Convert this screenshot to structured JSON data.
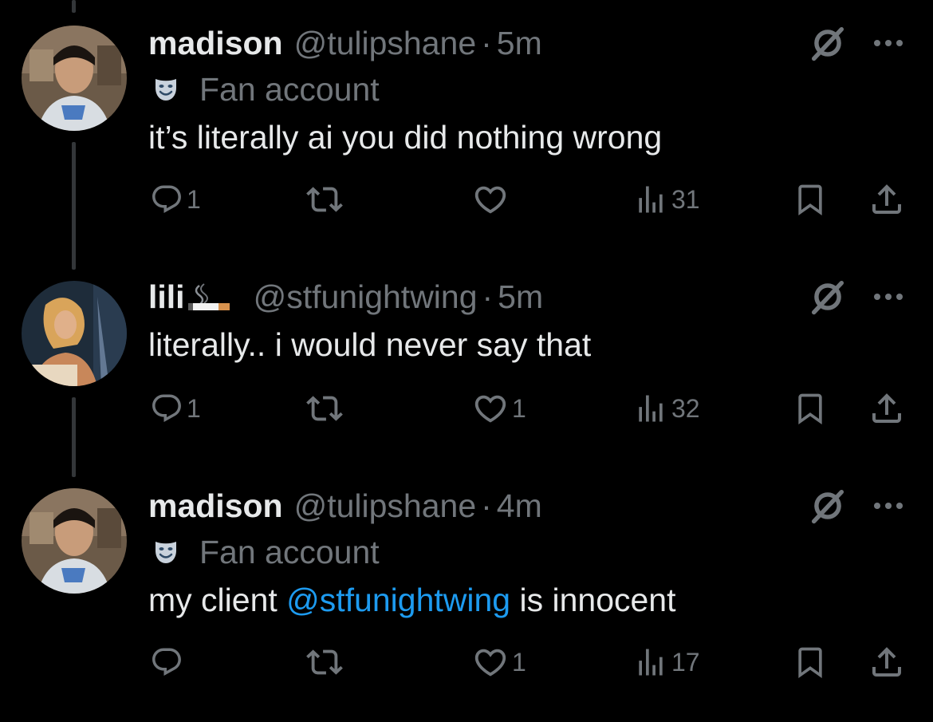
{
  "colors": {
    "background": "#000000",
    "text_primary": "#e7e9ea",
    "text_secondary": "#71767b",
    "link": "#1d9bf0",
    "thread_line": "#333639"
  },
  "tweets": [
    {
      "display_name": "madison",
      "handle": "@tulipshane",
      "time": "5m",
      "label": "Fan account",
      "label_icon": "theater-mask-icon",
      "text_parts": [
        "it’s literally ai you did nothing wrong"
      ],
      "counts": {
        "replies": "1",
        "retweets": "",
        "likes": "",
        "views": "31"
      }
    },
    {
      "display_name": "lili",
      "name_emoji": "cigarette-icon",
      "handle": "@stfunightwing",
      "time": "5m",
      "text_parts": [
        "literally.. i would never say that"
      ],
      "counts": {
        "replies": "1",
        "retweets": "",
        "likes": "1",
        "views": "32"
      }
    },
    {
      "display_name": "madison",
      "handle": "@tulipshane",
      "time": "4m",
      "label": "Fan account",
      "label_icon": "theater-mask-icon",
      "text_before": "my client ",
      "mention": "@stfunightwing",
      "text_after": " is innocent",
      "counts": {
        "replies": "",
        "retweets": "",
        "likes": "1",
        "views": "17"
      }
    }
  ],
  "separator": "·"
}
